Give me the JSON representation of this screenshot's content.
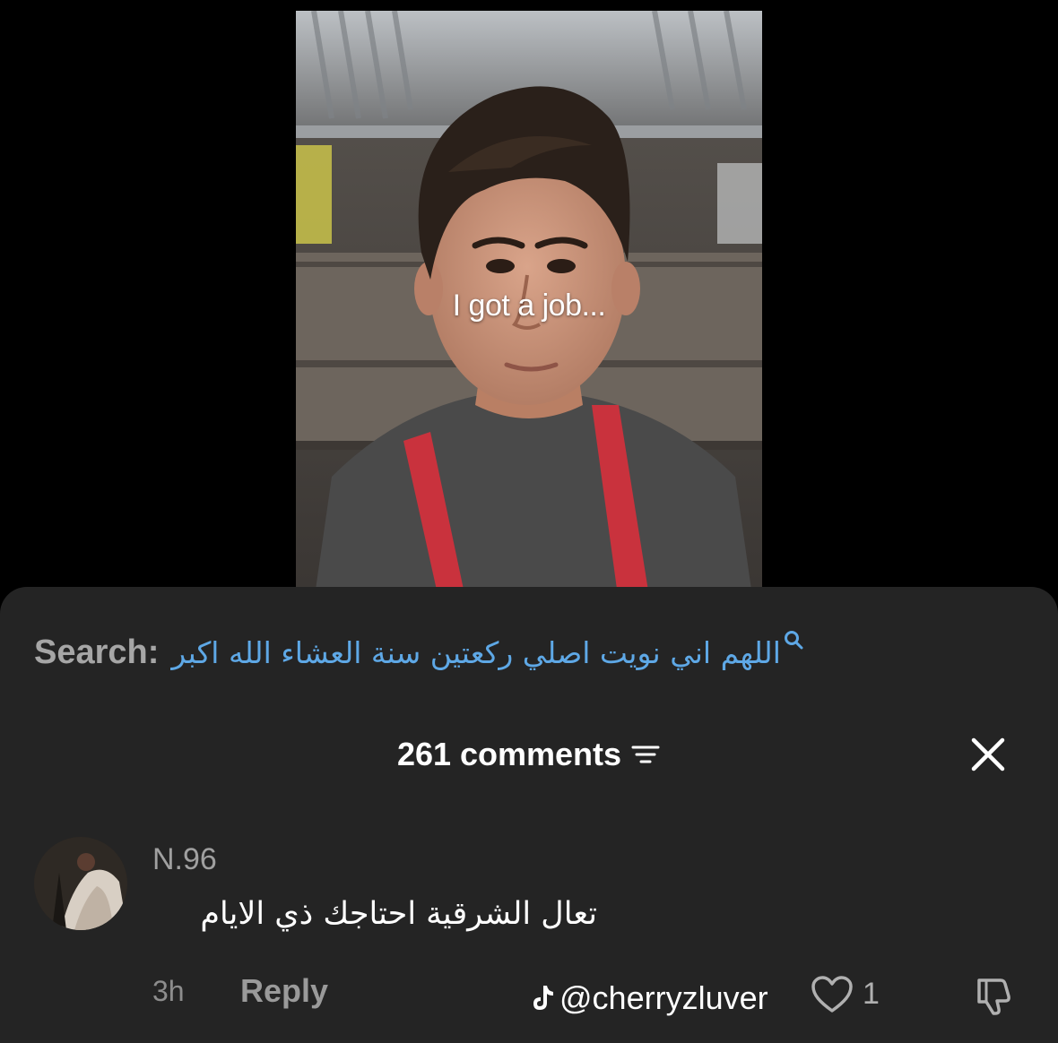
{
  "video": {
    "caption": "I got a job..."
  },
  "search": {
    "label": "Search:",
    "query": "اللهم اني نويت اصلي ركعتين سنة العشاء الله اكبر",
    "icon": "search-icon",
    "query_color": "#5ea8e6"
  },
  "comments_header": {
    "count_label": "261 comments",
    "sort_icon": "sort-icon",
    "close_icon": "close-icon"
  },
  "comment": {
    "username": "N.96",
    "text": "تعال الشرقية احتاجك ذي الايام",
    "time": "3h",
    "reply_label": "Reply",
    "like_count": "1",
    "like_icon": "heart-outline-icon",
    "dislike_icon": "thumbs-down-icon"
  },
  "watermark": {
    "icon": "tiktok-icon",
    "text": "@cherryzluver"
  },
  "colors": {
    "sheet_background": "#242424",
    "page_background": "#000000",
    "apron_red": "#c9323d"
  }
}
